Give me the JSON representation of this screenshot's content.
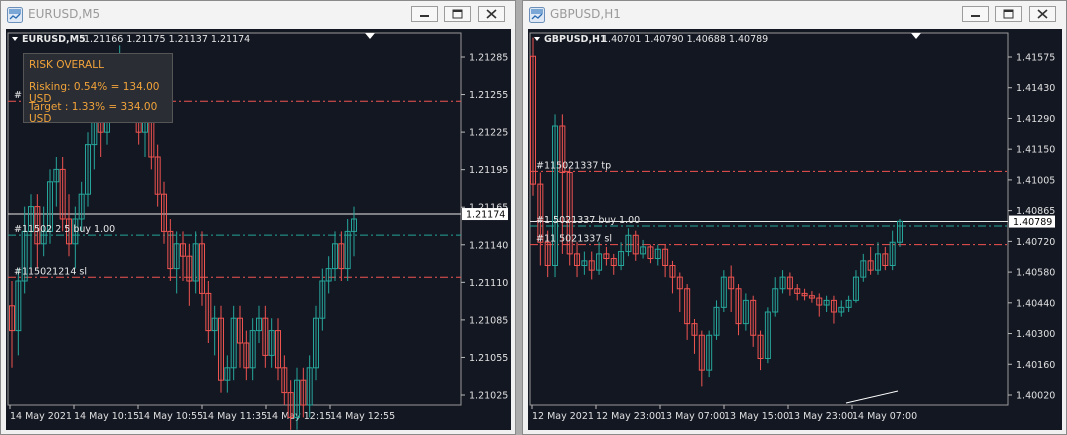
{
  "windows": [
    {
      "id": "eur",
      "title": "EURUSD,M5",
      "header": {
        "symbol": "EURUSD,M5",
        "ohlc": "1.21166 1.21175 1.21137 1.21174"
      },
      "risk_panel": {
        "title": "RISK OVERALL",
        "risking": "Risking: 0.54% = 134.00 USD",
        "target": "Target : 1.33% = 334.00 USD"
      },
      "line_labels": {
        "tp": "#",
        "buy": "#11502 2 5  buy 1.00",
        "sl": "#115021214 sl"
      },
      "current_price": "1.21174",
      "colors": {
        "bull": "#26a69a",
        "bear": "#ef5350",
        "tp": "#ef5350",
        "buy": "#26a69a",
        "sl": "#ef5350"
      },
      "chart_data": {
        "type": "candlestick",
        "price_ticks": [
          "1.21285",
          "1.21255",
          "1.21225",
          "1.21195",
          "1.21165",
          "1.21140",
          "1.21110",
          "1.21085",
          "1.21055",
          "1.21025"
        ],
        "time_labels": [
          "14 May 2021",
          "14 May 10:15",
          "14 May 10:55",
          "14 May 11:35",
          "14 May 12:15",
          "14 May 12:55"
        ],
        "ylim": [
          1.2102,
          1.2132
        ],
        "levels": {
          "tp": 1.21265,
          "buy": 1.21157,
          "sl": 1.21123,
          "current": 1.21174
        },
        "candles": [
          [
            1.211,
            1.2108,
            1.2112,
            1.2105
          ],
          [
            1.2108,
            1.2112,
            1.2113,
            1.2106
          ],
          [
            1.2112,
            1.2116,
            1.2118,
            1.2111
          ],
          [
            1.2116,
            1.2118,
            1.2119,
            1.2113
          ],
          [
            1.2118,
            1.2115,
            1.2119,
            1.2113
          ],
          [
            1.2115,
            1.2116,
            1.2118,
            1.2114
          ],
          [
            1.2116,
            1.212,
            1.2121,
            1.2115
          ],
          [
            1.212,
            1.2121,
            1.2122,
            1.2118
          ],
          [
            1.2121,
            1.2117,
            1.2122,
            1.2116
          ],
          [
            1.2117,
            1.2115,
            1.2119,
            1.2114
          ],
          [
            1.2115,
            1.2117,
            1.2118,
            1.2113
          ],
          [
            1.2117,
            1.2119,
            1.212,
            1.2116
          ],
          [
            1.2119,
            1.2123,
            1.2124,
            1.2118
          ],
          [
            1.2123,
            1.2125,
            1.2126,
            1.2121
          ],
          [
            1.2125,
            1.2124,
            1.2127,
            1.2122
          ],
          [
            1.2124,
            1.2127,
            1.2128,
            1.2123
          ],
          [
            1.2127,
            1.2128,
            1.213,
            1.2126
          ],
          [
            1.2128,
            1.2129,
            1.2131,
            1.2127
          ],
          [
            1.2129,
            1.2126,
            1.213,
            1.2125
          ],
          [
            1.2126,
            1.2127,
            1.2128,
            1.2125
          ],
          [
            1.2127,
            1.2124,
            1.2128,
            1.2123
          ],
          [
            1.2124,
            1.2125,
            1.2126,
            1.2122
          ],
          [
            1.2125,
            1.2122,
            1.2126,
            1.2121
          ],
          [
            1.2122,
            1.2119,
            1.2123,
            1.2118
          ],
          [
            1.2119,
            1.2116,
            1.212,
            1.2115
          ],
          [
            1.2116,
            1.2113,
            1.2117,
            1.2112
          ],
          [
            1.2113,
            1.2115,
            1.2116,
            1.2111
          ],
          [
            1.2115,
            1.2114,
            1.2116,
            1.2112
          ],
          [
            1.2114,
            1.2112,
            1.2115,
            1.211
          ],
          [
            1.2112,
            1.2115,
            1.2116,
            1.2111
          ],
          [
            1.2115,
            1.2111,
            1.2116,
            1.211
          ],
          [
            1.2111,
            1.2108,
            1.2112,
            1.2107
          ],
          [
            1.2108,
            1.2109,
            1.211,
            1.2106
          ],
          [
            1.2109,
            1.2104,
            1.211,
            1.2103
          ],
          [
            1.2104,
            1.2105,
            1.2106,
            1.2103
          ],
          [
            1.2105,
            1.2109,
            1.211,
            1.2104
          ],
          [
            1.2109,
            1.2107,
            1.211,
            1.2105
          ],
          [
            1.2107,
            1.2105,
            1.2108,
            1.2104
          ],
          [
            1.2105,
            1.2108,
            1.2109,
            1.2104
          ],
          [
            1.2108,
            1.2109,
            1.211,
            1.2107
          ],
          [
            1.2109,
            1.2106,
            1.211,
            1.2105
          ],
          [
            1.2106,
            1.2108,
            1.2109,
            1.2105
          ],
          [
            1.2108,
            1.2105,
            1.2109,
            1.2104
          ],
          [
            1.2105,
            1.2103,
            1.2106,
            1.2102
          ],
          [
            1.2103,
            1.2101,
            1.2104,
            1.21
          ],
          [
            1.2101,
            1.2104,
            1.2105,
            1.21
          ],
          [
            1.2104,
            1.2102,
            1.2105,
            1.2101
          ],
          [
            1.2102,
            1.2105,
            1.2106,
            1.2101
          ],
          [
            1.2105,
            1.2109,
            1.211,
            1.2104
          ],
          [
            1.2109,
            1.2112,
            1.2113,
            1.2108
          ],
          [
            1.2112,
            1.2113,
            1.2114,
            1.2111
          ],
          [
            1.2113,
            1.2115,
            1.2116,
            1.2112
          ],
          [
            1.2115,
            1.2113,
            1.2116,
            1.2112
          ],
          [
            1.2113,
            1.2116,
            1.2117,
            1.2112
          ],
          [
            1.2116,
            1.2117,
            1.2118,
            1.2114
          ]
        ]
      }
    },
    {
      "id": "gbp",
      "title": "GBPUSD,H1",
      "header": {
        "symbol": "GBPUSD,H1",
        "ohlc": "1.40701 1.40790 1.40688 1.40789"
      },
      "line_labels": {
        "tp": "#115021337 tp",
        "buy": "#1 5021337 buy 1.00",
        "sl": "#11 5021337 sl"
      },
      "current_price": "1.40789",
      "colors": {
        "bull": "#26a69a",
        "bear": "#ef5350",
        "tp": "#ef5350",
        "buy": "#26a69a",
        "sl": "#ef5350"
      },
      "chart_data": {
        "type": "candlestick",
        "price_ticks": [
          "1.41575",
          "1.41430",
          "1.41290",
          "1.41150",
          "1.41005",
          "1.40865",
          "1.40720",
          "1.40580",
          "1.40440",
          "1.40300",
          "1.40160",
          "1.40020"
        ],
        "time_labels": [
          "12 May 2021",
          "12 May 23:00",
          "13 May 07:00",
          "13 May 15:00",
          "13 May 23:00",
          "14 May 07:00"
        ],
        "ylim": [
          1.4,
          1.416
        ],
        "levels": {
          "tp": 1.41005,
          "buy": 1.4077,
          "sl": 1.4069,
          "current": 1.40789
        },
        "candles": [
          [
            1.415,
            1.4095,
            1.4158,
            1.409
          ],
          [
            1.4095,
            1.407,
            1.41,
            1.406
          ],
          [
            1.407,
            1.406,
            1.4075,
            1.4055
          ],
          [
            1.406,
            1.412,
            1.4125,
            1.4055
          ],
          [
            1.412,
            1.41,
            1.4125,
            1.4065
          ],
          [
            1.41,
            1.4065,
            1.4102,
            1.406
          ],
          [
            1.4065,
            1.406,
            1.407,
            1.4055
          ],
          [
            1.406,
            1.4062,
            1.4066,
            1.4056
          ],
          [
            1.4062,
            1.4058,
            1.4066,
            1.4054
          ],
          [
            1.4058,
            1.4065,
            1.407,
            1.4056
          ],
          [
            1.4065,
            1.4063,
            1.4068,
            1.406
          ],
          [
            1.4063,
            1.406,
            1.4065,
            1.4056
          ],
          [
            1.406,
            1.4066,
            1.407,
            1.4058
          ],
          [
            1.4066,
            1.4073,
            1.4076,
            1.4064
          ],
          [
            1.4073,
            1.4065,
            1.4075,
            1.4062
          ],
          [
            1.4065,
            1.4068,
            1.4071,
            1.4063
          ],
          [
            1.4068,
            1.4063,
            1.4069,
            1.4061
          ],
          [
            1.4063,
            1.4067,
            1.4069,
            1.406
          ],
          [
            1.4067,
            1.406,
            1.4069,
            1.4055
          ],
          [
            1.406,
            1.4055,
            1.4062,
            1.4048
          ],
          [
            1.4055,
            1.405,
            1.4057,
            1.404
          ],
          [
            1.405,
            1.4035,
            1.4052,
            1.4028
          ],
          [
            1.4035,
            1.403,
            1.4037,
            1.4022
          ],
          [
            1.403,
            1.4015,
            1.4032,
            1.4008
          ],
          [
            1.4015,
            1.403,
            1.4032,
            1.4012
          ],
          [
            1.403,
            1.4042,
            1.4045,
            1.4028
          ],
          [
            1.4042,
            1.4055,
            1.4058,
            1.404
          ],
          [
            1.4055,
            1.405,
            1.406,
            1.404
          ],
          [
            1.405,
            1.4035,
            1.4052,
            1.403
          ],
          [
            1.4035,
            1.4045,
            1.4048,
            1.4032
          ],
          [
            1.4045,
            1.403,
            1.4047,
            1.4025
          ],
          [
            1.403,
            1.402,
            1.4032,
            1.4015
          ],
          [
            1.402,
            1.404,
            1.4042,
            1.4018
          ],
          [
            1.404,
            1.405,
            1.4055,
            1.4038
          ],
          [
            1.405,
            1.4055,
            1.4058,
            1.4048
          ],
          [
            1.4055,
            1.405,
            1.4057,
            1.4047
          ],
          [
            1.405,
            1.4048,
            1.4052,
            1.4045
          ],
          [
            1.4048,
            1.4047,
            1.405,
            1.4045
          ],
          [
            1.4047,
            1.4046,
            1.4049,
            1.4044
          ],
          [
            1.4046,
            1.4043,
            1.4048,
            1.4038
          ],
          [
            1.4043,
            1.4045,
            1.4047,
            1.404
          ],
          [
            1.4045,
            1.404,
            1.4047,
            1.4035
          ],
          [
            1.404,
            1.4042,
            1.4045,
            1.4038
          ],
          [
            1.4042,
            1.4045,
            1.4047,
            1.404
          ],
          [
            1.4045,
            1.4055,
            1.4058,
            1.4044
          ],
          [
            1.4055,
            1.4062,
            1.4065,
            1.4053
          ],
          [
            1.4062,
            1.4058,
            1.4068,
            1.4056
          ],
          [
            1.4058,
            1.4065,
            1.407,
            1.4056
          ],
          [
            1.4065,
            1.406,
            1.4068,
            1.4058
          ],
          [
            1.406,
            1.407,
            1.4075,
            1.4058
          ],
          [
            1.407,
            1.4079,
            1.408,
            1.4068
          ]
        ]
      }
    }
  ]
}
